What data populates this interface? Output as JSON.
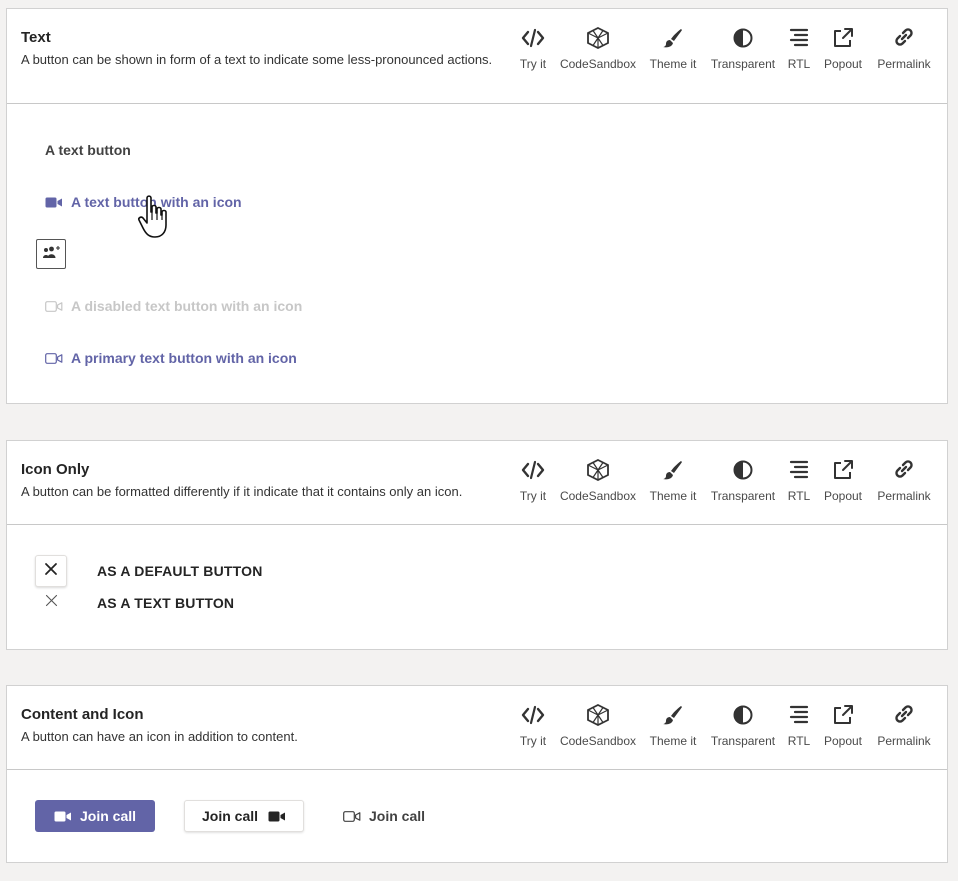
{
  "toolbar": {
    "try_it": "Try it",
    "codesandbox": "CodeSandbox",
    "theme_it": "Theme it",
    "transparent": "Transparent",
    "rtl": "RTL",
    "popout": "Popout",
    "permalink": "Permalink"
  },
  "sections": {
    "text": {
      "title": "Text",
      "description": "A button can be shown in form of a text to indicate some less-pronounced actions.",
      "buttons": {
        "plain": "A text button",
        "with_icon": "A text button with an icon",
        "disabled": "A disabled text button with an icon",
        "primary": "A primary text button with an icon"
      }
    },
    "icon_only": {
      "title": "Icon Only",
      "description": "A button can be formatted differently if it indicate that it contains only an icon.",
      "labels": {
        "default": "AS A DEFAULT BUTTON",
        "text": "AS A TEXT BUTTON"
      }
    },
    "content_icon": {
      "title": "Content and Icon",
      "description": "A button can have an icon in addition to content.",
      "buttons": {
        "primary": "Join call",
        "default": "Join call",
        "text": "Join call"
      }
    }
  },
  "colors": {
    "brand": "#6264a7",
    "disabled": "#c7c7c7",
    "text": "#242424"
  },
  "icons": [
    "code-icon",
    "codesandbox-icon",
    "brush-icon",
    "contrast-icon",
    "rtl-icon",
    "popout-icon",
    "link-icon",
    "video-camera-icon",
    "team-add-icon",
    "close-icon",
    "hand-cursor-icon"
  ]
}
